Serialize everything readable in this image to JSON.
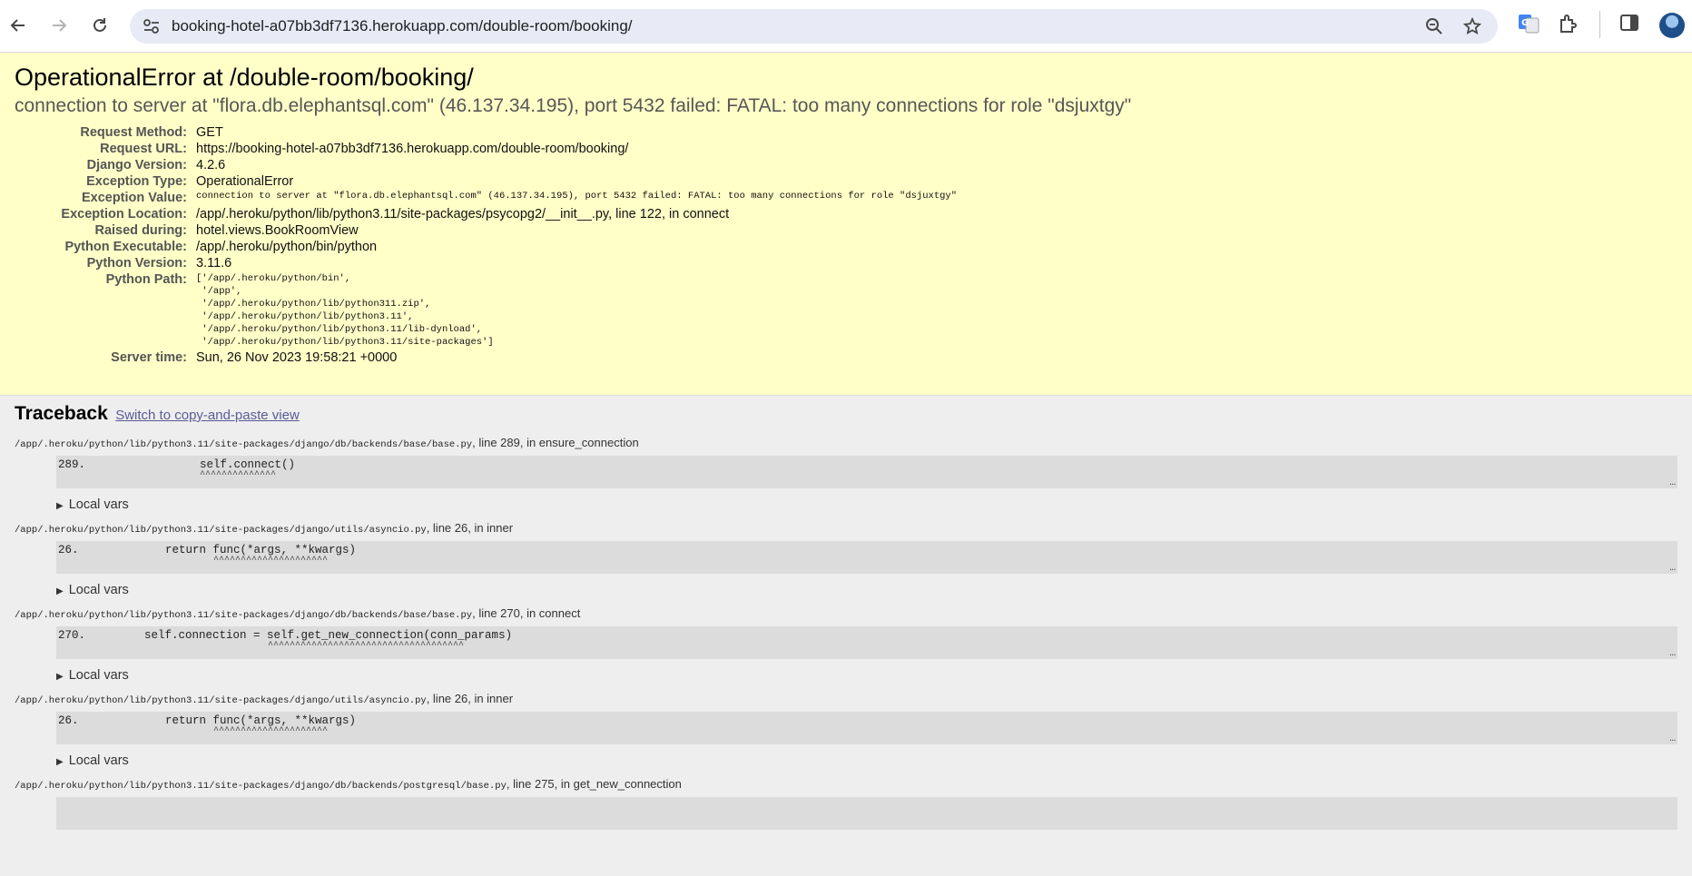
{
  "browser": {
    "url": "booking-hotel-a07bb3df7136.herokuapp.com/double-room/booking/"
  },
  "error": {
    "title": "OperationalError at /double-room/booking/",
    "message": "connection to server at \"flora.db.elephantsql.com\" (46.137.34.195), port 5432 failed: FATAL:  too many connections for role \"dsjuxtgy\"",
    "meta": [
      {
        "label": "Request Method:",
        "value": "GET",
        "mono": false
      },
      {
        "label": "Request URL:",
        "value": "https://booking-hotel-a07bb3df7136.herokuapp.com/double-room/booking/",
        "mono": false
      },
      {
        "label": "Django Version:",
        "value": "4.2.6",
        "mono": false
      },
      {
        "label": "Exception Type:",
        "value": "OperationalError",
        "mono": false
      },
      {
        "label": "Exception Value:",
        "value": "connection to server at \"flora.db.elephantsql.com\" (46.137.34.195), port 5432 failed: FATAL:  too many connections for role \"dsjuxtgy\"",
        "mono": true
      },
      {
        "label": "Exception Location:",
        "value": "/app/.heroku/python/lib/python3.11/site-packages/psycopg2/__init__.py, line 122, in connect",
        "mono": false
      },
      {
        "label": "Raised during:",
        "value": "hotel.views.BookRoomView",
        "mono": false
      },
      {
        "label": "Python Executable:",
        "value": "/app/.heroku/python/bin/python",
        "mono": false
      },
      {
        "label": "Python Version:",
        "value": "3.11.6",
        "mono": false
      }
    ],
    "python_path_label": "Python Path:",
    "python_path": "['/app/.heroku/python/bin',\n '/app',\n '/app/.heroku/python/lib/python311.zip',\n '/app/.heroku/python/lib/python3.11',\n '/app/.heroku/python/lib/python3.11/lib-dynload',\n '/app/.heroku/python/lib/python3.11/site-packages']",
    "server_time_label": "Server time:",
    "server_time": "Sun, 26 Nov 2023 19:58:21 +0000"
  },
  "traceback": {
    "heading": "Traceback",
    "switch_link": "Switch to copy-and-paste view",
    "local_vars_label": "Local vars",
    "frames": [
      {
        "file": "/app/.heroku/python/lib/python3.11/site-packages/django/db/backends/base/base.py",
        "where": ", line 289, in ensure_connection",
        "lineno": "289.",
        "code": "self.connect()",
        "carets": "^^^^^^^^^^^^^^"
      },
      {
        "file": "/app/.heroku/python/lib/python3.11/site-packages/django/utils/asyncio.py",
        "where": ", line 26, in inner",
        "lineno": "26.",
        "code": "return func(*args, **kwargs)",
        "carets": "^^^^^^^^^^^^^^^^^^^^^"
      },
      {
        "file": "/app/.heroku/python/lib/python3.11/site-packages/django/db/backends/base/base.py",
        "where": ", line 270, in connect",
        "lineno": "270.",
        "code": "self.connection = self.get_new_connection(conn_params)",
        "carets": "^^^^^^^^^^^^^^^^^^^^^^^^^^^^^^^^^^^^"
      },
      {
        "file": "/app/.heroku/python/lib/python3.11/site-packages/django/utils/asyncio.py",
        "where": ", line 26, in inner",
        "lineno": "26.",
        "code": "return func(*args, **kwargs)",
        "carets": "^^^^^^^^^^^^^^^^^^^^^"
      },
      {
        "file": "/app/.heroku/python/lib/python3.11/site-packages/django/db/backends/postgresql/base.py",
        "where": ", line 275, in get_new_connection",
        "lineno": "",
        "code": "",
        "carets": ""
      }
    ]
  }
}
